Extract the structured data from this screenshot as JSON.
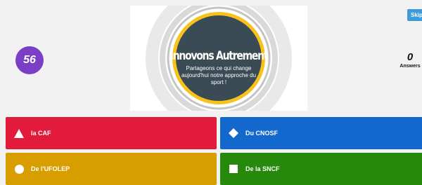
{
  "skip_label": "Skip",
  "timer": {
    "value": "56"
  },
  "answers": {
    "count": "0",
    "label": "Answers"
  },
  "media": {
    "title": "Innovons Autrement",
    "subtitle": "Partageons ce qui change aujourd'hui notre approche du sport !"
  },
  "choices": [
    {
      "label": "la CAF",
      "icon": "triangle-icon",
      "color": "#e21b3c"
    },
    {
      "label": "Du CNOSF",
      "icon": "diamond-icon",
      "color": "#1368ce"
    },
    {
      "label": "De l'UFOLEP",
      "icon": "circle-icon",
      "color": "#d89e00"
    },
    {
      "label": "De la SNCF",
      "icon": "square-icon",
      "color": "#26890c"
    }
  ]
}
